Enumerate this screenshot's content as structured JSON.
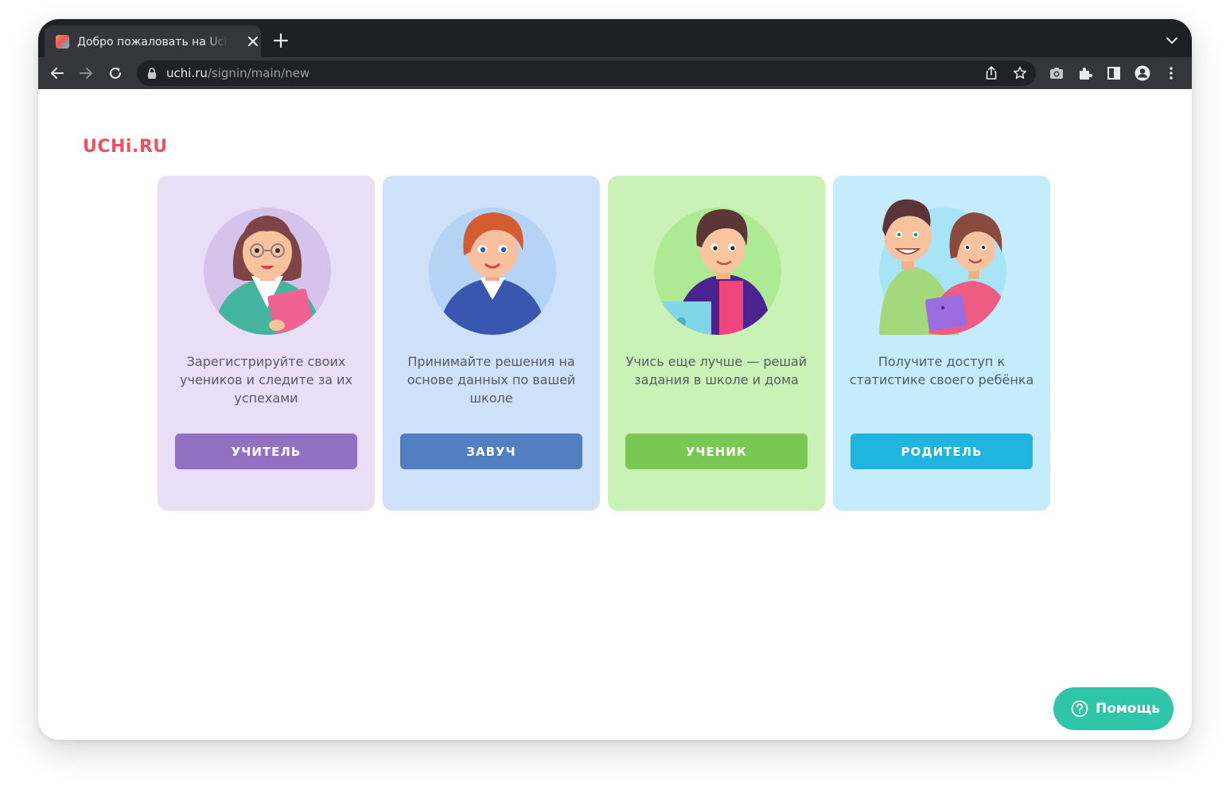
{
  "browser": {
    "tab_title": "Добро пожаловать на Uchi.ru",
    "url_host": "uchi.ru",
    "url_path": "/signin/main/new"
  },
  "page": {
    "logo": "UCHi.RU",
    "cards": [
      {
        "text": "Зарегистрируйте своих учеников и следите за их успехами",
        "button": "УЧИТЕЛЬ",
        "bg": "#e9ddf8",
        "button_color": "#9371c2"
      },
      {
        "text": "Принимайте решения на основе данных по вашей школе",
        "button": "ЗАВУЧ",
        "bg": "#cde1f8",
        "button_color": "#517fc2"
      },
      {
        "text": "Учись еще лучше — решай задания в школе и дома",
        "button": "УЧЕНИК",
        "bg": "#cbf2b6",
        "button_color": "#78c852"
      },
      {
        "text": "Получите доступ к статистике своего ребёнка",
        "button": "РОДИТЕЛЬ",
        "bg": "#c5ecfc",
        "button_color": "#20b5df"
      }
    ],
    "help_label": "Помощь",
    "colors": {
      "brand": "#ef4f5f",
      "help": "#2ec5a8"
    }
  }
}
